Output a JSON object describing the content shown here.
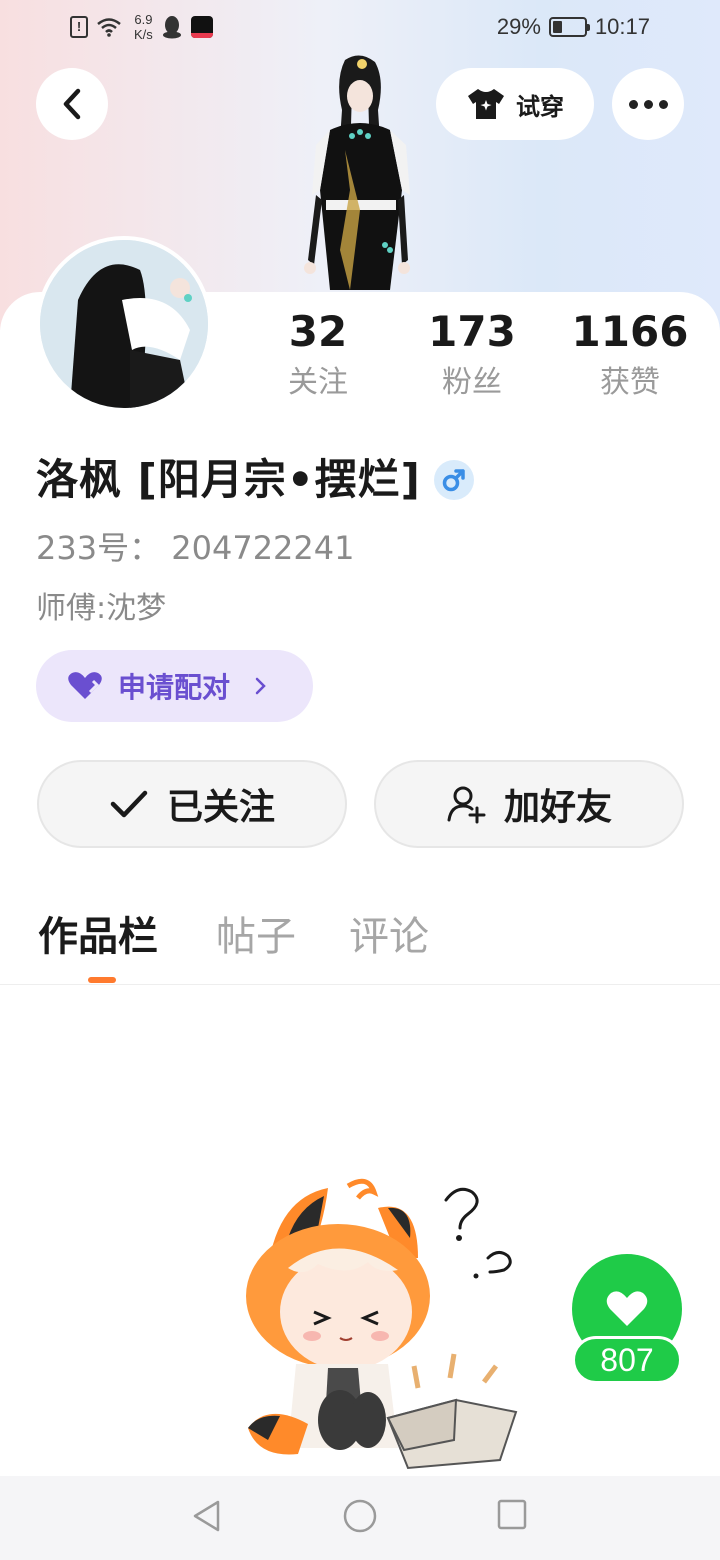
{
  "status_bar": {
    "net_speed_value": "6.9",
    "net_speed_unit": "K/s",
    "battery": "29%",
    "time": "10:17"
  },
  "header": {
    "try_on_label": "试穿"
  },
  "profile": {
    "stats": [
      {
        "value": "32",
        "label": "关注"
      },
      {
        "value": "173",
        "label": "粉丝"
      },
      {
        "value": "1166",
        "label": "获赞"
      }
    ],
    "username": "洛枫 [阳月宗•摆烂]",
    "gender_symbol": "♂",
    "id_line": "233号： 204722241",
    "master_line": "师傅:沈梦",
    "pair_button_label": "申请配对"
  },
  "actions": {
    "follow_label": "已关注",
    "add_friend_label": "加好友"
  },
  "tabs": [
    {
      "label": "作品栏",
      "active": true
    },
    {
      "label": "帖子",
      "active": false
    },
    {
      "label": "评论",
      "active": false
    }
  ],
  "like": {
    "count": "807"
  },
  "colors": {
    "accent_orange": "#ff7a2e",
    "pair_purple": "#6a4fd0",
    "like_green": "#1fcb48",
    "gender_blue": "#3a8ee6"
  },
  "icons": {
    "back": "chevron-left-icon",
    "try_on": "tshirt-icon",
    "more": "more-dots-icon",
    "pair": "heart-icon",
    "follow": "check-icon",
    "add_friend": "add-user-icon",
    "like": "heart-icon"
  }
}
